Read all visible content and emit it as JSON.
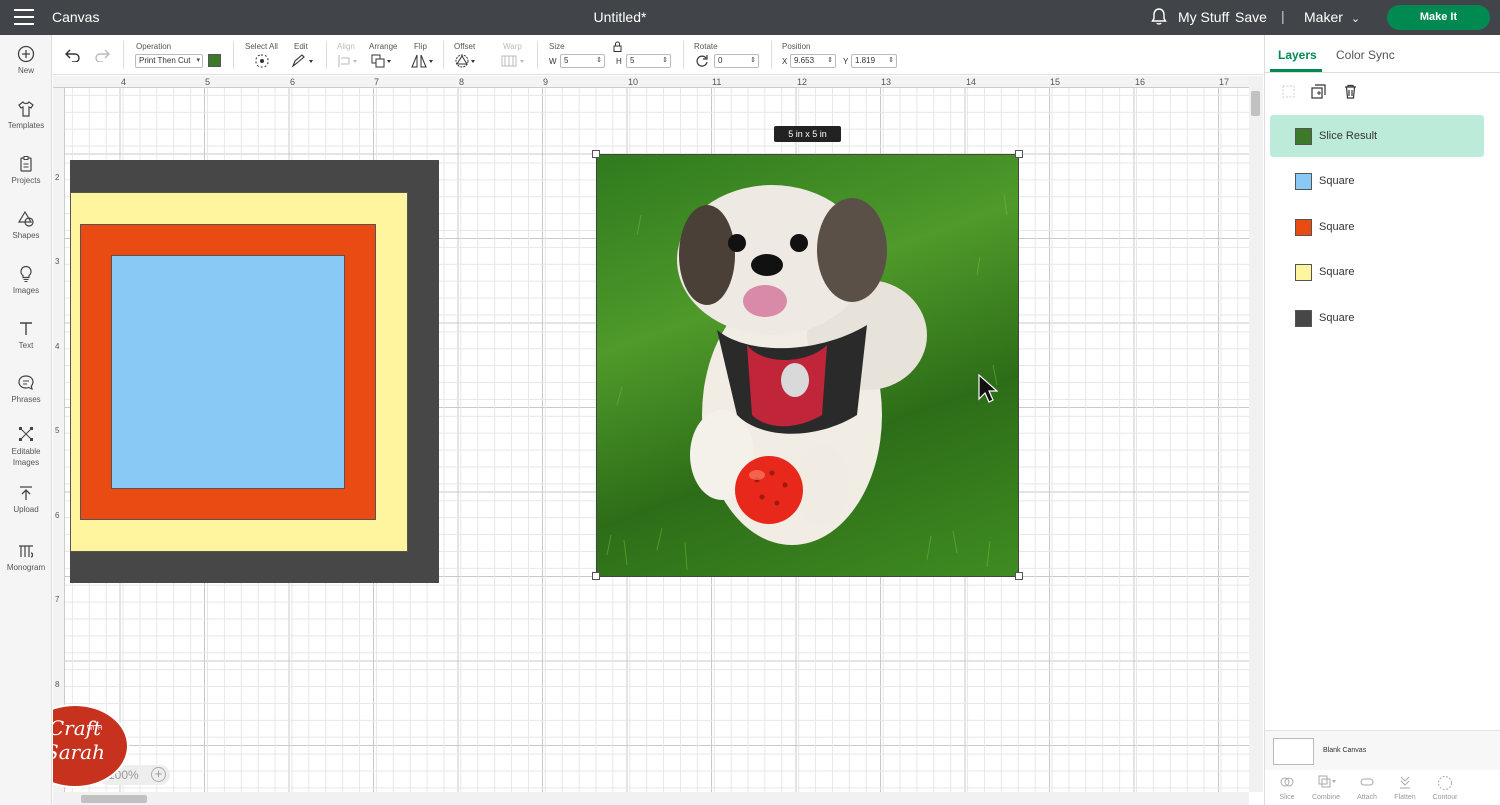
{
  "topbar": {
    "app_title": "Canvas",
    "doc_title": "Untitled*",
    "my_stuff": "My Stuff",
    "save": "Save",
    "separator": "|",
    "machine": "Maker",
    "make_it": "Make It"
  },
  "sidebar": {
    "items": [
      {
        "label": "New",
        "icon": "plus-circle-icon"
      },
      {
        "label": "Templates",
        "icon": "shirt-icon"
      },
      {
        "label": "Projects",
        "icon": "clipboard-icon"
      },
      {
        "label": "Shapes",
        "icon": "shapes-icon"
      },
      {
        "label": "Images",
        "icon": "lightbulb-icon"
      },
      {
        "label": "Text",
        "icon": "text-icon"
      },
      {
        "label": "Phrases",
        "icon": "speech-bubble-icon"
      },
      {
        "label": "Editable Images",
        "icon": "editable-image-icon"
      },
      {
        "label": "Upload",
        "icon": "upload-icon"
      },
      {
        "label": "Monogram",
        "icon": "monogram-icon"
      }
    ]
  },
  "toolbar": {
    "operation_label": "Operation",
    "operation_value": "Print Then Cut",
    "select_all_label": "Select All",
    "edit_label": "Edit",
    "align_label": "Align",
    "arrange_label": "Arrange",
    "flip_label": "Flip",
    "offset_label": "Offset",
    "warp_label": "Warp",
    "size_label": "Size",
    "w_label": "W",
    "w_value": "5",
    "h_label": "H",
    "h_value": "5",
    "rotate_label": "Rotate",
    "rotate_value": "0",
    "position_label": "Position",
    "x_label": "X",
    "x_value": "9.653",
    "y_label": "Y",
    "y_value": "1.819"
  },
  "ruler": {
    "top": [
      "4",
      "5",
      "6",
      "7",
      "8",
      "9",
      "10",
      "11",
      "12",
      "13",
      "14",
      "15",
      "16",
      "17"
    ],
    "left": [
      "2",
      "3",
      "4",
      "5",
      "6",
      "7",
      "8"
    ]
  },
  "canvas": {
    "size_tag": "5  in x 5  in",
    "square_colors": {
      "dark": "#474747",
      "yellow": "#fff59e",
      "orange": "#e94b12",
      "blue": "#89c9f5"
    },
    "zoom": "100%"
  },
  "panel": {
    "tabs": [
      "Layers",
      "Color Sync"
    ],
    "layers": [
      {
        "name": "Slice Result",
        "color": "#3c7a2a",
        "selected": true
      },
      {
        "name": "Square",
        "color": "#89c9f5"
      },
      {
        "name": "Square",
        "color": "#e94b12"
      },
      {
        "name": "Square",
        "color": "#fff59e"
      },
      {
        "name": "Square",
        "color": "#474747"
      }
    ],
    "blank_canvas": "Blank Canvas",
    "bottom_tools": [
      "Slice",
      "Combine",
      "Attach",
      "Flatten",
      "Contour"
    ]
  },
  "watermark": {
    "line1": "Craft",
    "line2": "WITH",
    "line3": "Sarah"
  },
  "colors": {
    "topbar": "#414549",
    "make_it": "#008a51",
    "layer_selected": "#bdebd9",
    "accent": "#008a51"
  }
}
